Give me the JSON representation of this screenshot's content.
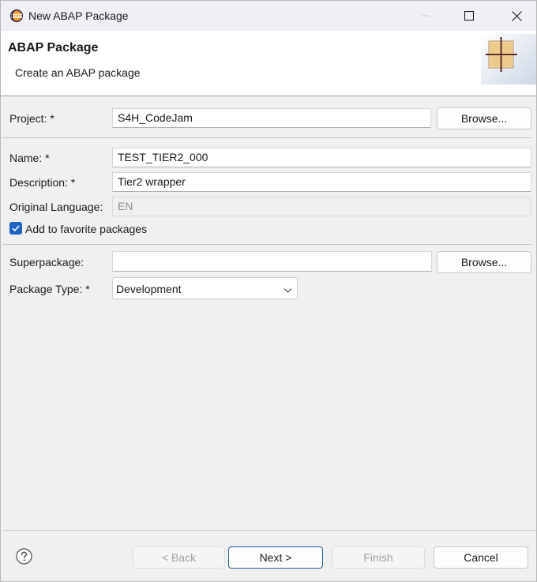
{
  "window": {
    "title": "New ABAP Package",
    "app_icon": "eclipse-icon",
    "controls": [
      "minimize-icon",
      "maximize-icon",
      "close-icon"
    ]
  },
  "banner": {
    "title": "ABAP Package",
    "description": "Create an ABAP package",
    "image": "package-wizard-icon"
  },
  "form": {
    "project": {
      "label": "Project: *",
      "value": "S4H_CodeJam",
      "browse": "Browse..."
    },
    "name": {
      "label": "Name: *",
      "value": "TEST_TIER2_000"
    },
    "description": {
      "label": "Description: *",
      "value": "Tier2 wrapper"
    },
    "language": {
      "label": "Original Language:",
      "value": "EN"
    },
    "favorite": {
      "label": "Add to favorite packages",
      "checked": true
    },
    "superpackage": {
      "label": "Superpackage:",
      "value": "",
      "browse": "Browse..."
    },
    "package_type": {
      "label": "Package Type: *",
      "value": "Development"
    }
  },
  "footer": {
    "help_icon": "help-icon",
    "back": "< Back",
    "next": "Next >",
    "finish": "Finish",
    "cancel": "Cancel"
  },
  "colors": {
    "accent": "#1f63c5",
    "primary_border": "#1f5f9b"
  }
}
